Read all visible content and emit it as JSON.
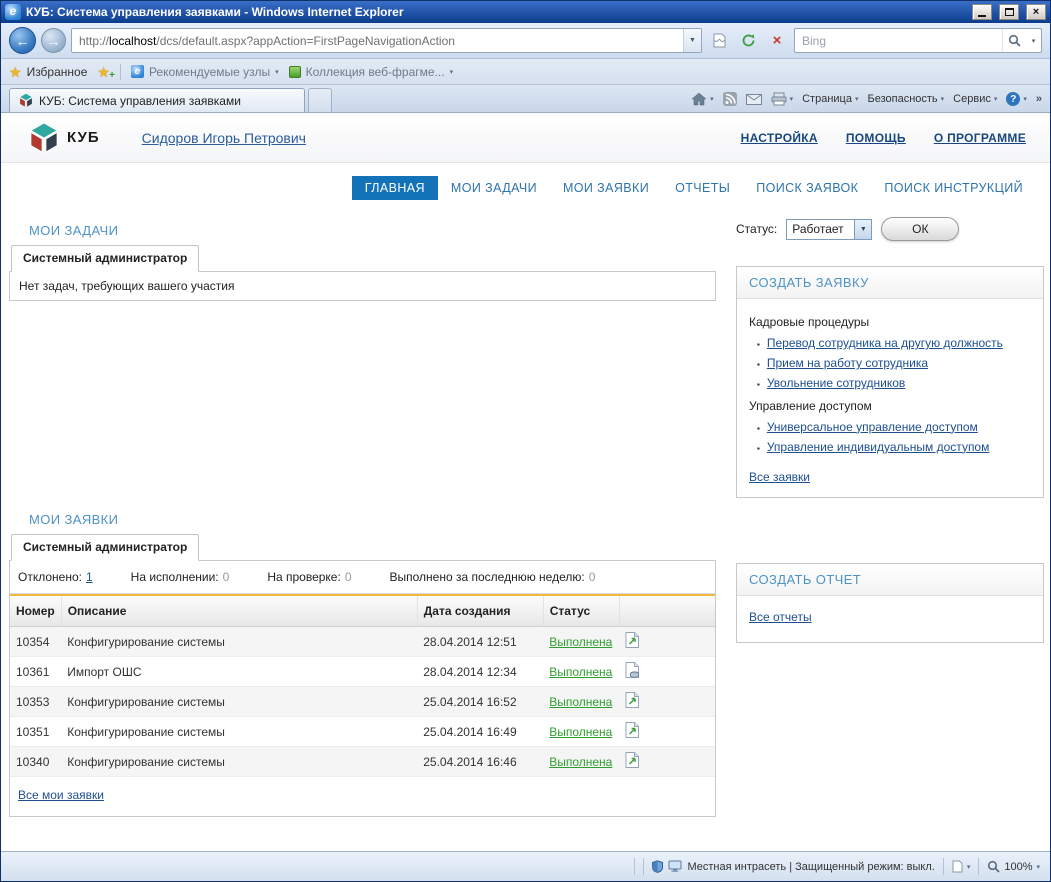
{
  "window": {
    "title": "КУБ: Система управления заявками - Windows Internet Explorer"
  },
  "address_bar": {
    "protocol": "http://",
    "host": "localhost",
    "path": "/dcs/default.aspx?appAction=FirstPageNavigationAction"
  },
  "search": {
    "placeholder": "Bing"
  },
  "favorites_bar": {
    "favorites_label": "Избранное",
    "items": [
      "Рекомендуемые узлы",
      "Коллекция веб-фрагме..."
    ]
  },
  "browser_tab": {
    "title": "КУБ: Система управления заявками"
  },
  "command_bar": {
    "page": "Страница",
    "safety": "Безопасность",
    "tools": "Сервис"
  },
  "page_header": {
    "logo": "КУБ",
    "user": "Сидоров Игорь Петрович",
    "links": [
      "НАСТРОЙКА",
      "ПОМОЩЬ",
      "О ПРОГРАММЕ"
    ]
  },
  "nav": {
    "tabs": [
      {
        "label": "ГЛАВНАЯ",
        "active": true
      },
      {
        "label": "МОИ ЗАДАЧИ",
        "active": false
      },
      {
        "label": "МОИ ЗАЯВКИ",
        "active": false
      },
      {
        "label": "ОТЧЕТЫ",
        "active": false
      },
      {
        "label": "ПОИСК ЗАЯВОК",
        "active": false
      },
      {
        "label": "ПОИСК ИНСТРУКЦИЙ",
        "active": false
      }
    ]
  },
  "my_tasks": {
    "heading": "МОИ ЗАДАЧИ",
    "tab": "Системный администратор",
    "empty": "Нет задач, требующих вашего участия"
  },
  "status_control": {
    "label": "Статус:",
    "value": "Работает",
    "ok": "ОК"
  },
  "create_request": {
    "heading": "СОЗДАТЬ ЗАЯВКУ",
    "groups": [
      {
        "title": "Кадровые процедуры",
        "links": [
          "Перевод сотрудника на другую должность",
          "Прием на работу сотрудника",
          "Увольнение сотрудников"
        ]
      },
      {
        "title": "Управление доступом",
        "links": [
          "Универсальное управление доступом",
          "Управление индивидуальным доступом"
        ]
      }
    ],
    "all": "Все заявки"
  },
  "my_requests": {
    "heading": "МОИ ЗАЯВКИ",
    "tab": "Системный администратор",
    "stats": [
      {
        "label": "Отклонено:",
        "value": "1"
      },
      {
        "label": "На исполнении:",
        "value": "0"
      },
      {
        "label": "На проверке:",
        "value": "0"
      },
      {
        "label": "Выполнено за последнюю неделю:",
        "value": "0"
      }
    ],
    "table": {
      "headers": [
        "Номер",
        "Описание",
        "Дата создания",
        "Статус"
      ],
      "rows": [
        {
          "number": "10354",
          "description": "Конфигурирование системы",
          "date": "28.04.2014 12:51",
          "status": "Выполнена",
          "icon": "request-document-icon"
        },
        {
          "number": "10361",
          "description": "Импорт ОШС",
          "date": "28.04.2014 12:34",
          "status": "Выполнена",
          "icon": "request-document-icon"
        },
        {
          "number": "10353",
          "description": "Конфигурирование системы",
          "date": "25.04.2014 16:52",
          "status": "Выполнена",
          "icon": "request-document-icon"
        },
        {
          "number": "10351",
          "description": "Конфигурирование системы",
          "date": "25.04.2014 16:49",
          "status": "Выполнена",
          "icon": "request-document-icon"
        },
        {
          "number": "10340",
          "description": "Конфигурирование системы",
          "date": "25.04.2014 16:46",
          "status": "Выполнена",
          "icon": "request-document-icon"
        }
      ]
    },
    "all": "Все мои заявки"
  },
  "create_report": {
    "heading": "СОЗДАТЬ ОТЧЕТ",
    "all": "Все отчеты"
  },
  "status_bar": {
    "zone": "Местная интрасеть | Защищенный режим: выкл.",
    "zoom": "100%"
  },
  "colors": {
    "accent_blue": "#1273b9",
    "link_blue": "#1d4f91",
    "heading_blue": "#4e93c6",
    "status_green": "#2f9e2f",
    "header_stripe_yellow": "#f0b93d",
    "titlebar_blue": "#0b3c8d"
  },
  "icons": {
    "caret": "▾",
    "dropdown": "▼",
    "back_arrow": "←",
    "forward_arrow": "→",
    "close": "×",
    "stop": "×",
    "star": "★",
    "plus": "+",
    "chevron_right": "»",
    "help": "?",
    "bullet": "▪"
  }
}
